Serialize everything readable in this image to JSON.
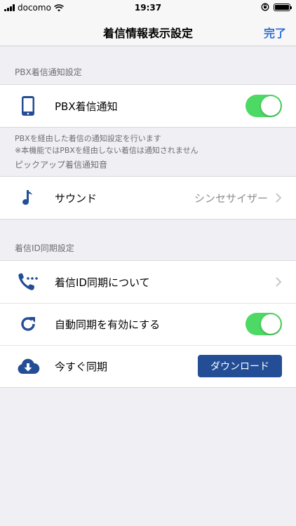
{
  "status_bar": {
    "carrier": "docomo",
    "time": "19:37"
  },
  "nav": {
    "title": "着信情報表示設定",
    "done_label": "完了"
  },
  "sections": {
    "pbx": {
      "header": "PBX着信通知設定",
      "row_label": "PBX着信通知",
      "toggle_on": true,
      "footer_line1": "PBXを経由した着信の通知設定を行います",
      "footer_line2": "※本機能ではPBXを経由しない着信は通知されません"
    },
    "pickup": {
      "header": "ピックアップ着信通知音",
      "row_label": "サウンド",
      "row_value": "シンセサイザー"
    },
    "sync": {
      "header": "着信ID同期設定",
      "about_label": "着信ID同期について",
      "auto_label": "自動同期を有効にする",
      "auto_toggle_on": true,
      "now_label": "今すぐ同期",
      "download_label": "ダウンロード"
    }
  },
  "colors": {
    "accent": "#2f6fd6",
    "icon_blue": "#234e96",
    "toggle_green": "#4cd964",
    "button_bg": "#234e96"
  },
  "icons": [
    "smartphone-icon",
    "music-note-icon",
    "phone-dots-icon",
    "refresh-icon",
    "cloud-download-icon",
    "chevron-right-icon"
  ]
}
